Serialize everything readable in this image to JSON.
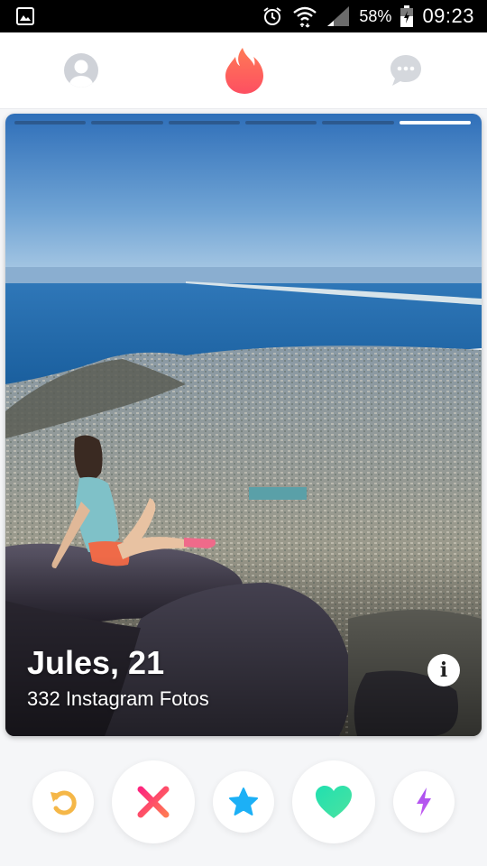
{
  "status_bar": {
    "battery": "58%",
    "time": "09:23",
    "icons": [
      "image-notification-icon",
      "alarm-icon",
      "wifi-icon",
      "signal-icon",
      "battery-icon"
    ]
  },
  "nav": {
    "icons": [
      "profile-icon",
      "tinder-flame-icon",
      "messages-icon"
    ],
    "accent": "#fd5564",
    "inactive_color": "#d5d8dd"
  },
  "card": {
    "photo_count": 6,
    "active_photo_index": 5,
    "name_age": "Jules, 21",
    "subtitle": "332 Instagram Fotos",
    "info_label": "i"
  },
  "actions": {
    "rewind": {
      "icon": "rewind-icon",
      "color": "#f5b748"
    },
    "nope": {
      "icon": "x-icon",
      "color": "#fd4d67"
    },
    "super_like": {
      "icon": "star-icon",
      "color": "#1cb0f6"
    },
    "like": {
      "icon": "heart-icon",
      "color": "#3ee5b0"
    },
    "boost": {
      "icon": "lightning-icon",
      "color": "#a64ff0"
    }
  }
}
